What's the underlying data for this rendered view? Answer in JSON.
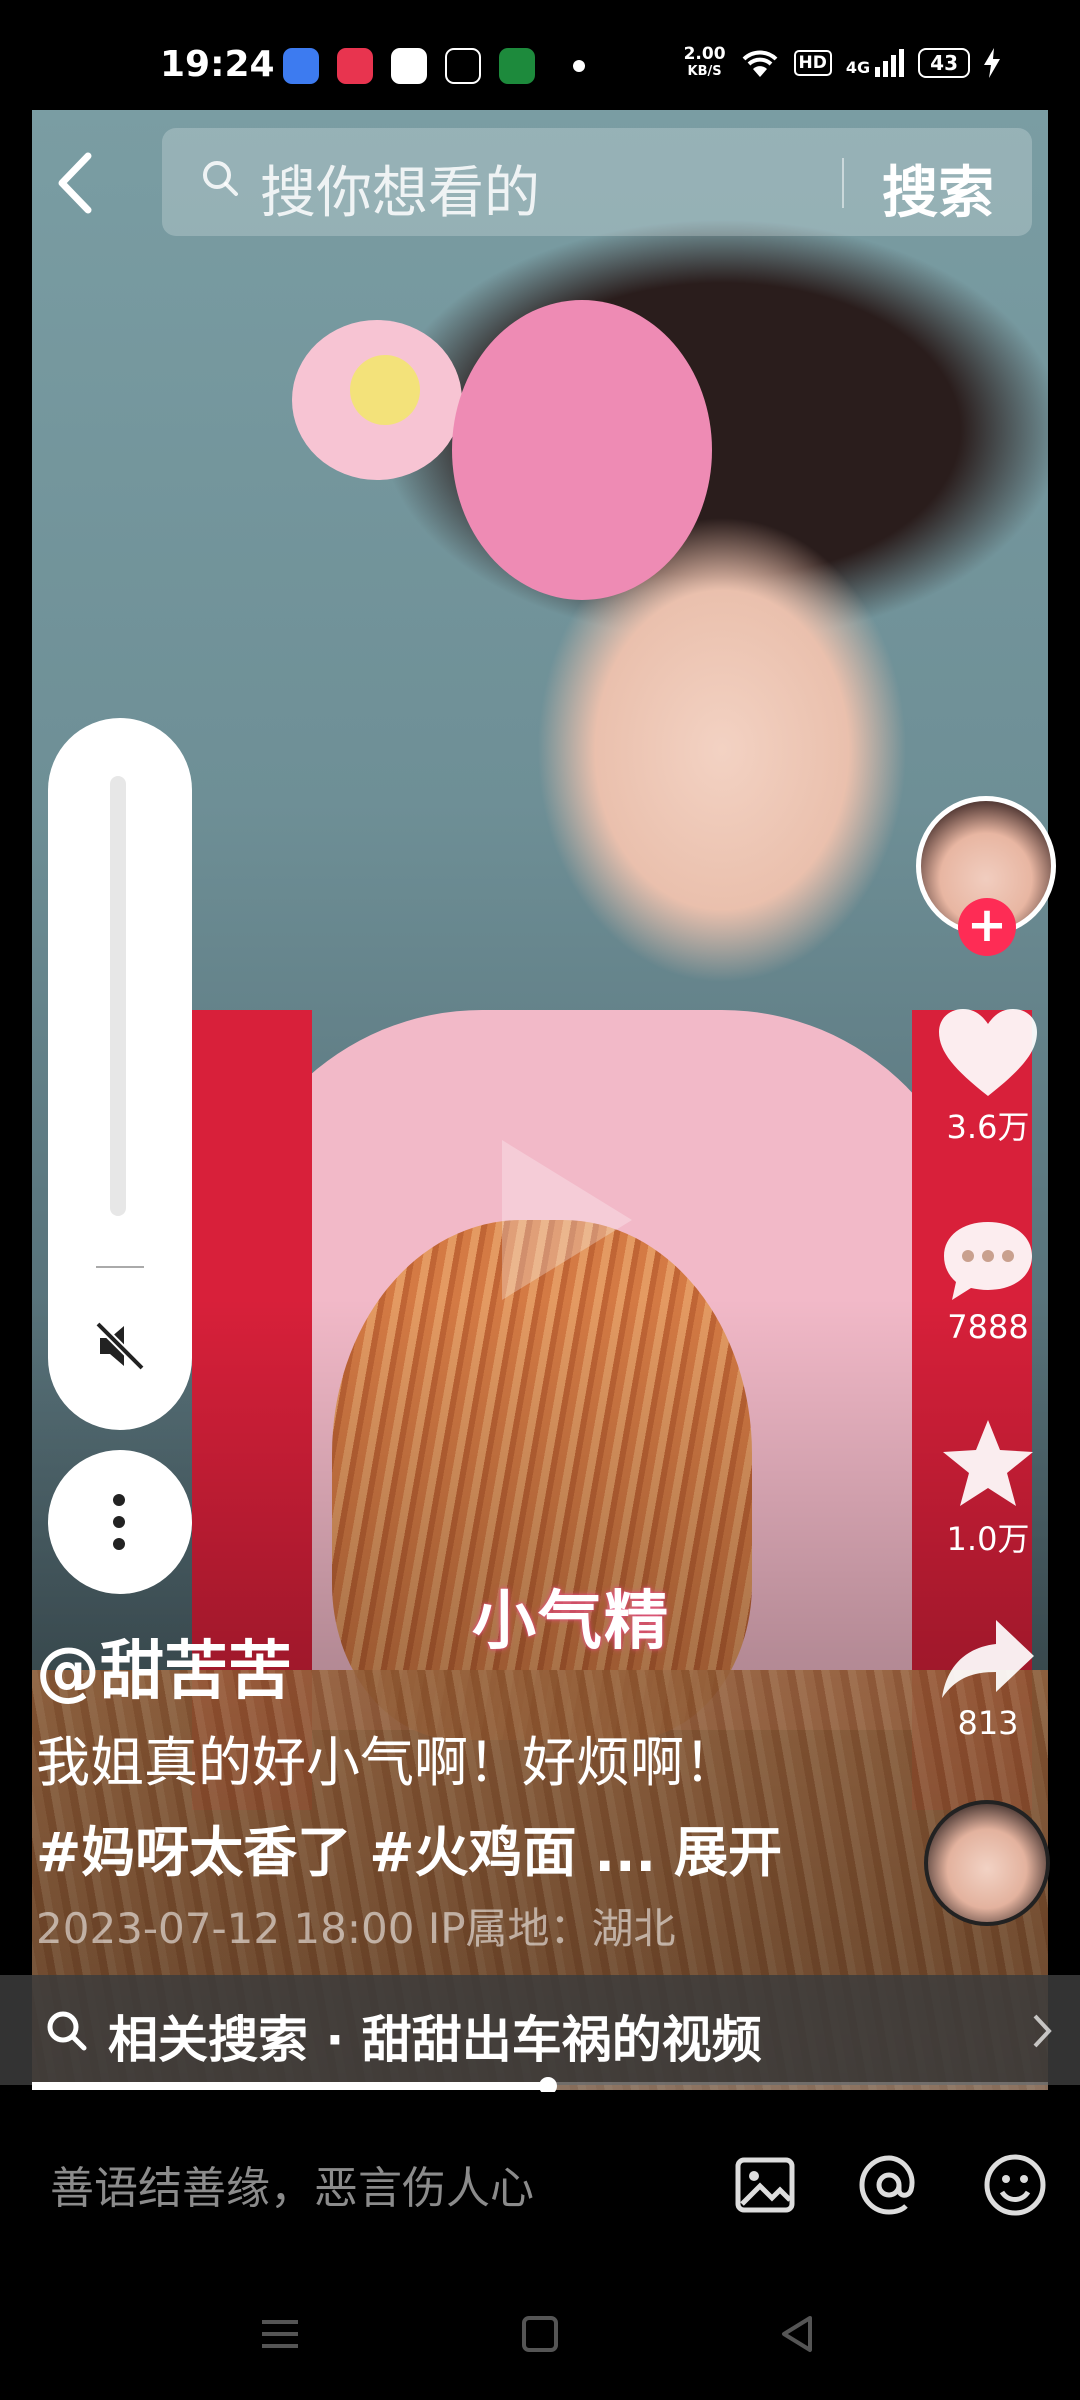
{
  "status_bar": {
    "time": "19:24",
    "net_speed_value": "2.00",
    "net_speed_unit": "KB/S",
    "hd": "HD",
    "network": "4G",
    "battery": "43",
    "app_icons": [
      "cloud-app-icon",
      "video-app-icon",
      "shield-app-icon",
      "tiktok-icon",
      "oppo-app-icon"
    ]
  },
  "search": {
    "placeholder": "搜你想看的",
    "button": "搜索"
  },
  "video": {
    "sticker_text": "小气精"
  },
  "actions": {
    "likes": "3.6万",
    "comments": "7888",
    "favorites": "1.0万",
    "shares": "813"
  },
  "post": {
    "author": "@甜苦苦",
    "description": "我姐真的好小气啊！好烦啊！",
    "tags": [
      "#妈呀太香了",
      "#火鸡面"
    ],
    "ellipsis": "...",
    "expand": "展开",
    "date_ip": "2023-07-12 18:00  IP属地：湖北"
  },
  "related": {
    "text": "相关搜索 · 甜甜出车祸的视频"
  },
  "progress": {
    "fraction": 0.508
  },
  "comment": {
    "placeholder": "善语结善缘，恶言伤人心"
  },
  "colors": {
    "accent": "#fe2c55",
    "background": "#000000"
  }
}
